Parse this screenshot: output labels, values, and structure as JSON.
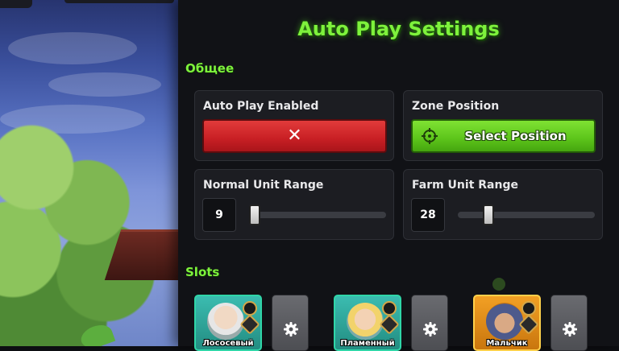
{
  "panel": {
    "title": "Auto Play Settings",
    "general_label": "Общее",
    "slots_label": "Slots"
  },
  "auto_play": {
    "label": "Auto Play Enabled",
    "toggle_symbol": "✕",
    "enabled": false
  },
  "zone_position": {
    "label": "Zone Position",
    "button_label": "Select Position",
    "icon": "crosshair-icon"
  },
  "normal_range": {
    "label": "Normal Unit Range",
    "value": "9",
    "slider_fraction": 0.0
  },
  "farm_range": {
    "label": "Farm Unit Range",
    "value": "28",
    "slider_fraction": 0.2
  },
  "slots": [
    {
      "name": "Лососевый",
      "rarity": "green"
    },
    {
      "name": "Пламенный",
      "rarity": "green"
    },
    {
      "name": "Мальчик",
      "rarity": "gold"
    }
  ],
  "colors": {
    "accent_green": "#7ef23c",
    "button_red": "#c81f24",
    "button_green": "#5cc41a",
    "panel_bg": "#111216",
    "card_bg": "#1c1d22"
  }
}
